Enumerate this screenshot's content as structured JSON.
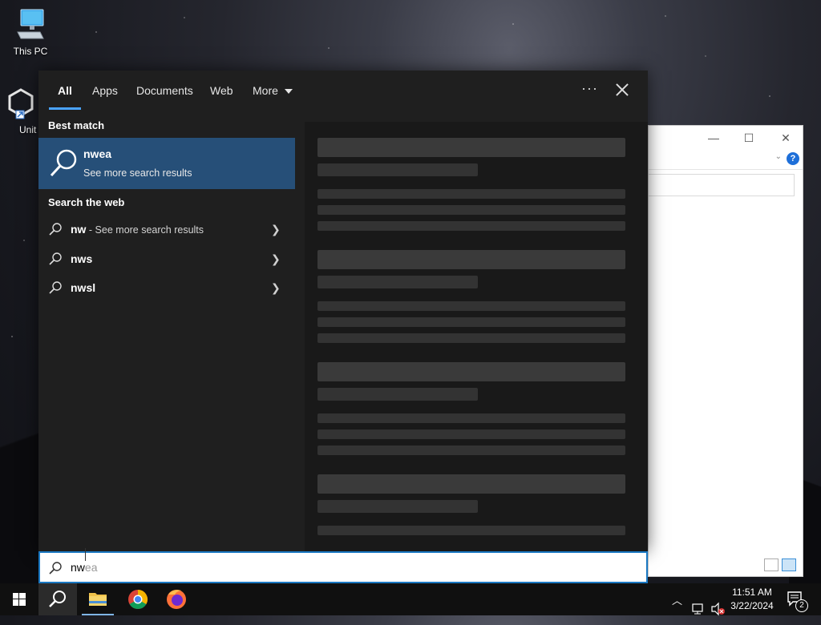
{
  "desktop": {
    "icons": [
      {
        "label": "This PC"
      },
      {
        "label": "Unit"
      }
    ]
  },
  "search": {
    "tabs": [
      {
        "label": "All"
      },
      {
        "label": "Apps"
      },
      {
        "label": "Documents"
      },
      {
        "label": "Web"
      },
      {
        "label": "More"
      }
    ],
    "best_match_heading": "Best match",
    "best_match": {
      "title": "nwea",
      "subtitle": "See more search results"
    },
    "web_heading": "Search the web",
    "web_results": [
      {
        "term": "nw",
        "suffix": " - See more search results"
      },
      {
        "term": "nws",
        "suffix": ""
      },
      {
        "term": "nwsl",
        "suffix": ""
      }
    ],
    "query_typed": "nw",
    "query_suggestion": "ea"
  },
  "taskbar": {
    "time": "11:51 AM",
    "date": "3/22/2024",
    "notification_count": "2"
  },
  "colors": {
    "accent": "#1a78c2",
    "best_match_bg": "#264f78",
    "panel_bg": "#1f1f1f"
  }
}
